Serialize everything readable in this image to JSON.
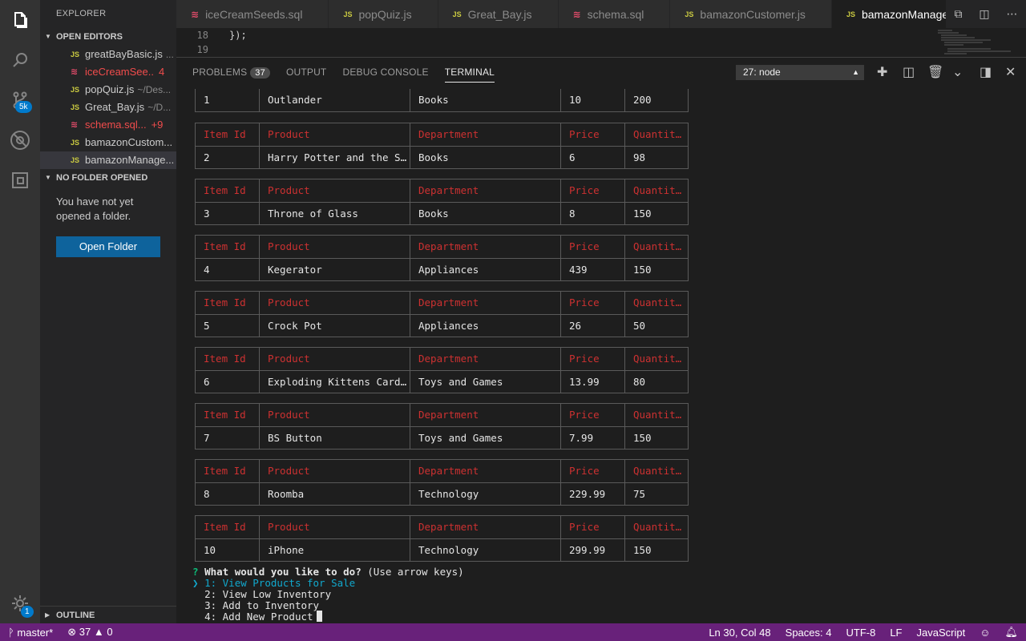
{
  "sidebar": {
    "title": "EXPLORER",
    "open_editors_label": "OPEN EDITORS",
    "open_editors": [
      {
        "icon": "JS",
        "name": "greatBayBasic.js",
        "path": "...",
        "count": "",
        "error": false
      },
      {
        "icon": "db",
        "name": "iceCreamSee..",
        "path": "",
        "count": "4",
        "error": true
      },
      {
        "icon": "JS",
        "name": "popQuiz.js",
        "path": "~/Des...",
        "count": "",
        "error": false
      },
      {
        "icon": "JS",
        "name": "Great_Bay.js",
        "path": "~/D...",
        "count": "",
        "error": false
      },
      {
        "icon": "db",
        "name": "schema.sql...",
        "path": "",
        "count": "+9",
        "error": true
      },
      {
        "icon": "JS",
        "name": "bamazonCustom...",
        "path": "",
        "count": "",
        "error": false
      },
      {
        "icon": "JS",
        "name": "bamazonManage...",
        "path": "",
        "count": "",
        "error": false
      }
    ],
    "no_folder_label": "NO FOLDER OPENED",
    "no_folder_msg": "You have not yet opened a folder.",
    "open_folder_button": "Open Folder",
    "outline_label": "OUTLINE"
  },
  "activity": {
    "scm_badge": "5k",
    "settings_badge": "1"
  },
  "tabs": [
    {
      "icon": "db",
      "label": "iceCreamSeeds.sql",
      "active": false
    },
    {
      "icon": "JS",
      "label": "popQuiz.js",
      "active": false
    },
    {
      "icon": "JS",
      "label": "Great_Bay.js",
      "active": false
    },
    {
      "icon": "db",
      "label": "schema.sql",
      "active": false
    },
    {
      "icon": "JS",
      "label": "bamazonCustomer.js",
      "active": false
    },
    {
      "icon": "JS",
      "label": "bamazonManager.js",
      "active": true
    }
  ],
  "editor": {
    "lines": [
      {
        "num": "18",
        "code": "});"
      },
      {
        "num": "19",
        "code": ""
      }
    ]
  },
  "panel": {
    "tabs": [
      {
        "label": "PROBLEMS",
        "count": "37",
        "active": false
      },
      {
        "label": "OUTPUT",
        "count": "",
        "active": false
      },
      {
        "label": "DEBUG CONSOLE",
        "count": "",
        "active": false
      },
      {
        "label": "TERMINAL",
        "count": "",
        "active": true
      }
    ],
    "terminal_select": "27: node"
  },
  "terminal": {
    "headers": [
      "Item Id",
      "Product",
      "Department",
      "Price",
      "Quantit…"
    ],
    "first_row": [
      "1",
      "Outlander",
      "Books",
      "10",
      "200"
    ],
    "tables": [
      [
        "2",
        "Harry Potter and the S…",
        "Books",
        "6",
        "98"
      ],
      [
        "3",
        "Throne of Glass",
        "Books",
        "8",
        "150"
      ],
      [
        "4",
        "Kegerator",
        "Appliances",
        "439",
        "150"
      ],
      [
        "5",
        "Crock Pot",
        "Appliances",
        "26",
        "50"
      ],
      [
        "6",
        "Exploding Kittens Card…",
        "Toys and Games",
        "13.99",
        "80"
      ],
      [
        "7",
        "BS Button",
        "Toys and Games",
        "7.99",
        "150"
      ],
      [
        "8",
        "Roomba",
        "Technology",
        "229.99",
        "75"
      ],
      [
        "10",
        "iPhone",
        "Technology",
        "299.99",
        "150"
      ]
    ],
    "prompt_mark": "?",
    "prompt_question": "What would you like to do?",
    "prompt_hint": "(Use arrow keys)",
    "pointer": "❯",
    "options": [
      "1: View Products for Sale",
      "2: View Low Inventory",
      "3: Add to Inventory",
      "4: Add New Product"
    ]
  },
  "status": {
    "branch": "master*",
    "errors": "37",
    "warnings": "0",
    "position": "Ln 30, Col 48",
    "spaces": "Spaces: 4",
    "encoding": "UTF-8",
    "eol": "LF",
    "language": "JavaScript"
  },
  "colors": {
    "status_bar": "#68217a",
    "header_text": "#cd3131",
    "selected_option": "#11a8cd",
    "prompt_mark": "#0dbc79"
  }
}
